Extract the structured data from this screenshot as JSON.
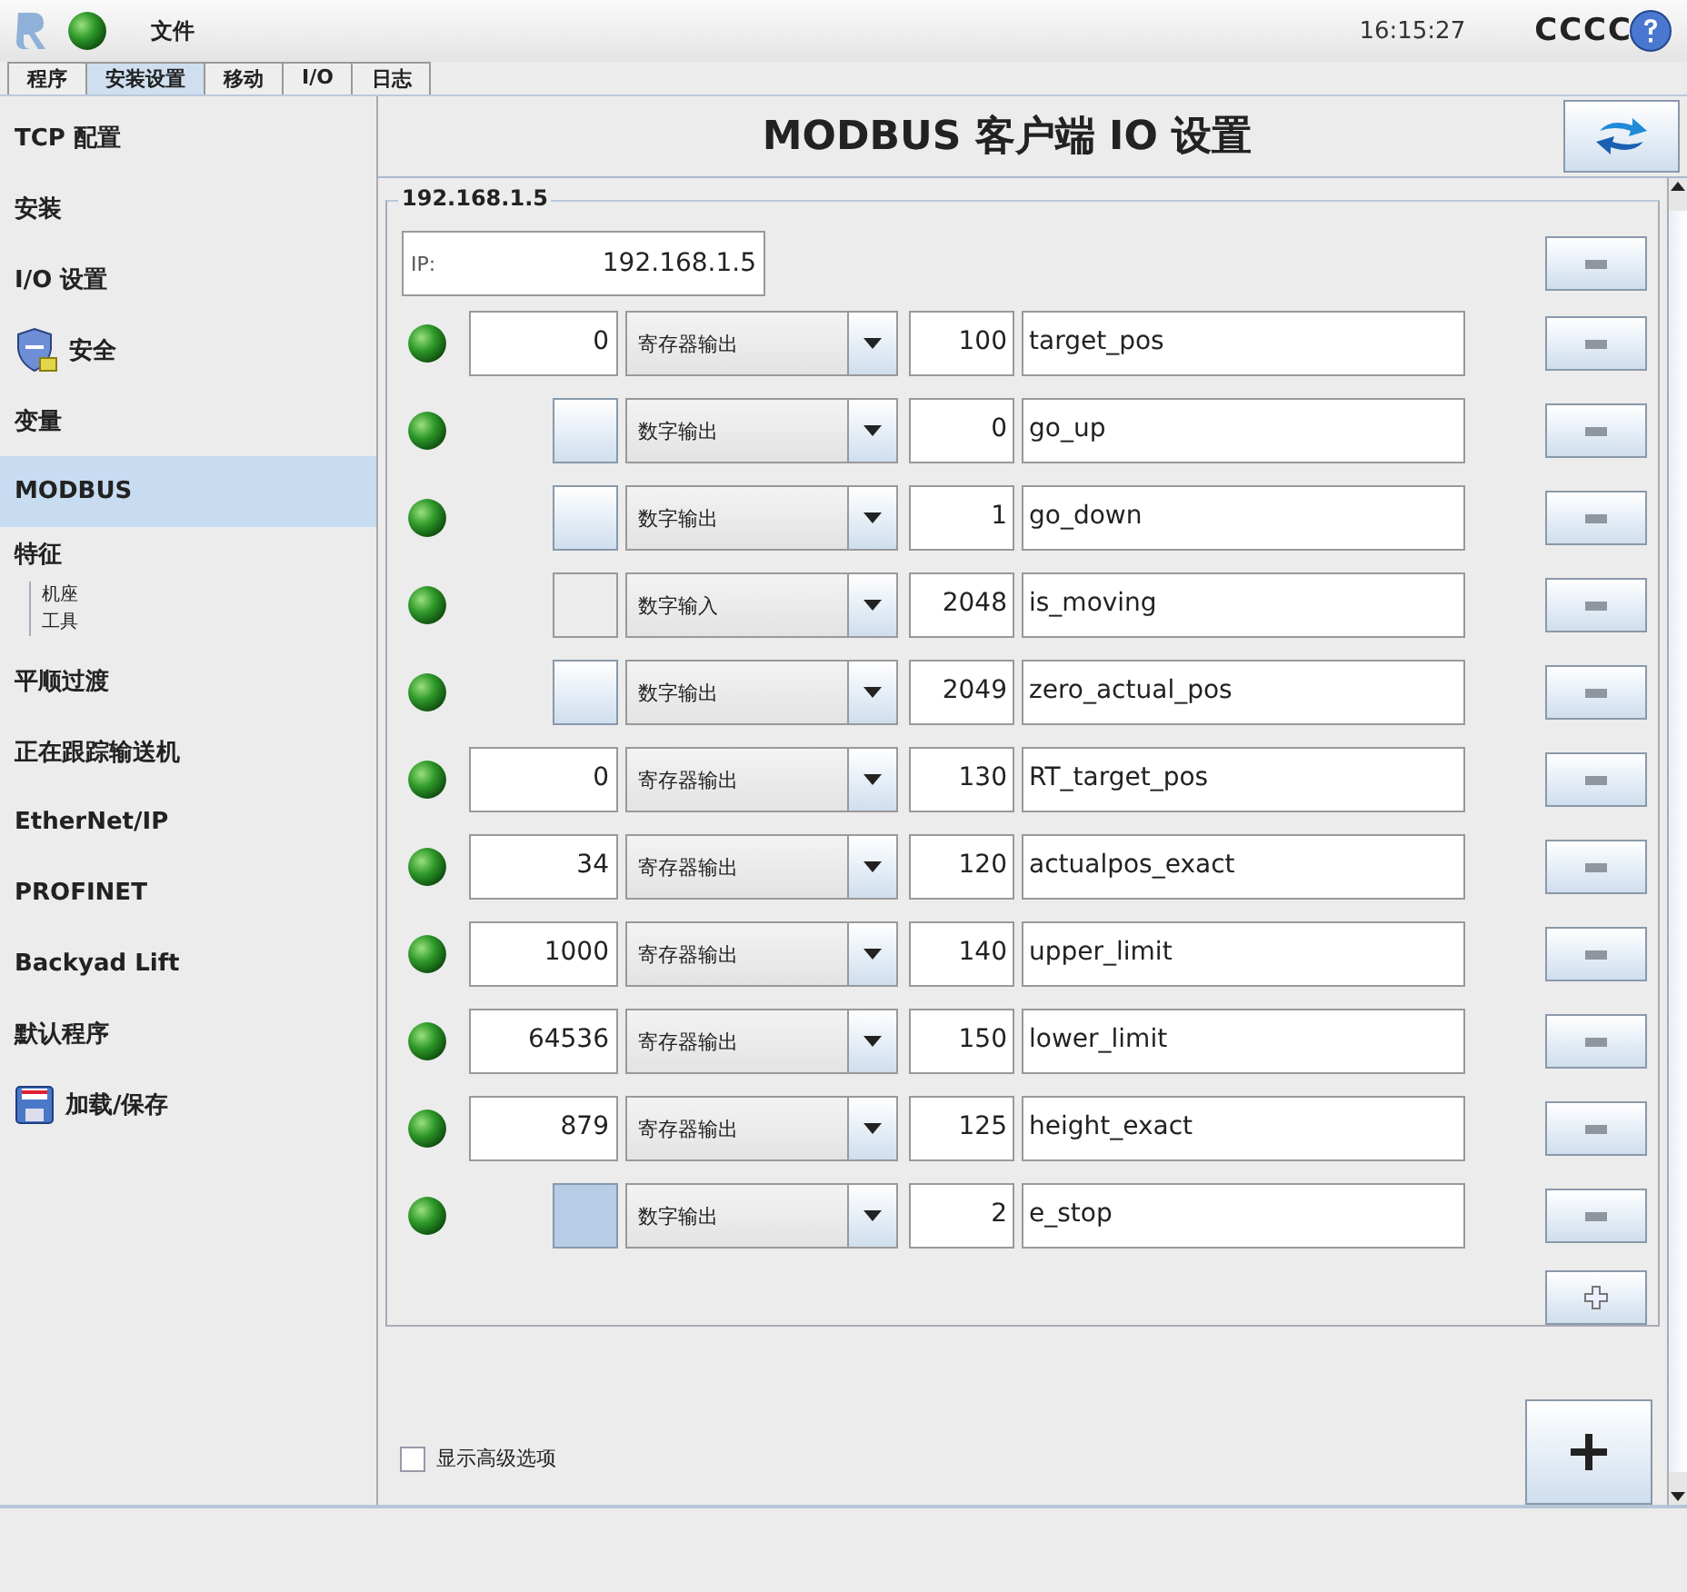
{
  "top_bar": {
    "menu": "文件",
    "time": "16:15:27",
    "robot_name": "CCCC"
  },
  "tabs": [
    {
      "label": "程序",
      "selected": false
    },
    {
      "label": "安装设置",
      "selected": true
    },
    {
      "label": "移动",
      "selected": false
    },
    {
      "label": "I/O",
      "selected": false
    },
    {
      "label": "日志",
      "selected": false
    }
  ],
  "sidebar": {
    "items": [
      {
        "label": "TCP 配置",
        "selected": false
      },
      {
        "label": "安装",
        "selected": false
      },
      {
        "label": "I/O 设置",
        "selected": false
      },
      {
        "label": "安全",
        "selected": false
      },
      {
        "label": "变量",
        "selected": false
      },
      {
        "label": "MODBUS",
        "selected": true
      },
      {
        "label": "特征",
        "selected": false,
        "children": [
          {
            "label": "机座"
          },
          {
            "label": "工具"
          }
        ]
      },
      {
        "label": "平顺过渡",
        "selected": false
      },
      {
        "label": "正在跟踪输送机",
        "selected": false
      },
      {
        "label": "EtherNet/IP",
        "selected": false
      },
      {
        "label": "PROFINET",
        "selected": false
      },
      {
        "label": "Backyad Lift",
        "selected": false
      },
      {
        "label": "默认程序",
        "selected": false
      },
      {
        "label": "加载/保存",
        "selected": false
      }
    ]
  },
  "main": {
    "title": "MODBUS 客户端 IO 设置",
    "group_label": "192.168.1.5",
    "ip_label": "IP:",
    "ip_value": "192.168.1.5",
    "signals": [
      {
        "kind": "register",
        "value": "0",
        "type": "寄存器输出",
        "address": "100",
        "name": "target_pos"
      },
      {
        "kind": "digital_output",
        "on": false,
        "type": "数字输出",
        "address": "0",
        "name": "go_up"
      },
      {
        "kind": "digital_output",
        "on": false,
        "type": "数字输出",
        "address": "1",
        "name": "go_down"
      },
      {
        "kind": "digital_input",
        "on": false,
        "type": "数字输入",
        "address": "2048",
        "name": "is_moving"
      },
      {
        "kind": "digital_output",
        "on": false,
        "type": "数字输出",
        "address": "2049",
        "name": "zero_actual_pos"
      },
      {
        "kind": "register",
        "value": "0",
        "type": "寄存器输出",
        "address": "130",
        "name": "RT_target_pos"
      },
      {
        "kind": "register",
        "value": "34",
        "type": "寄存器输出",
        "address": "120",
        "name": "actualpos_exact"
      },
      {
        "kind": "register",
        "value": "1000",
        "type": "寄存器输出",
        "address": "140",
        "name": "upper_limit"
      },
      {
        "kind": "register",
        "value": "64536",
        "type": "寄存器输出",
        "address": "150",
        "name": "lower_limit"
      },
      {
        "kind": "register",
        "value": "879",
        "type": "寄存器输出",
        "address": "125",
        "name": "height_exact"
      },
      {
        "kind": "digital_output",
        "on": true,
        "type": "数字输出",
        "address": "2",
        "name": "e_stop"
      }
    ],
    "advanced_option": {
      "label": "显示高级选项",
      "checked": false
    }
  }
}
